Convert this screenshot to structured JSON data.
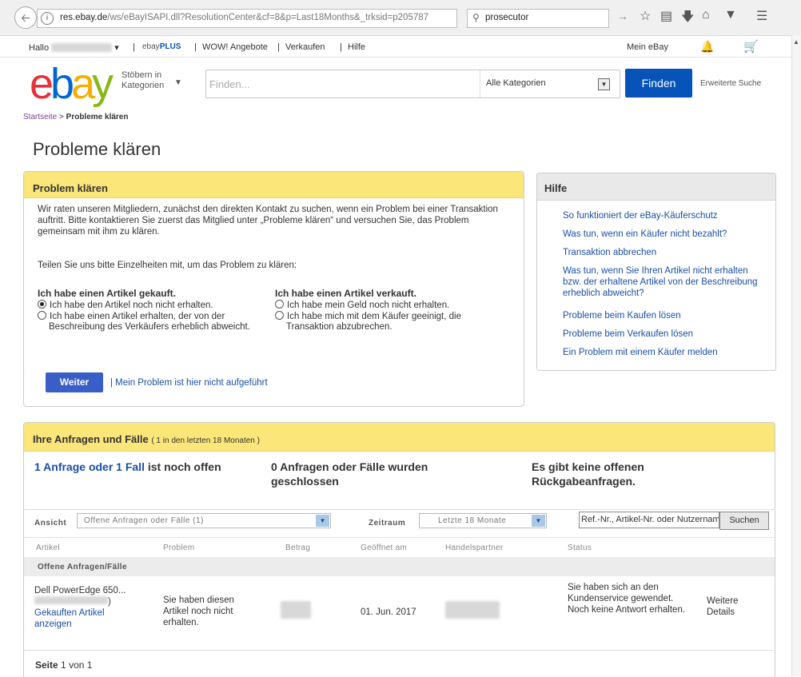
{
  "browser": {
    "url_domain": "res.ebay.de",
    "url_path": "/ws/eBayISAPI.dll?ResolutionCenter&cf=8&p=Last18Months&_trksid=p205787",
    "search_value": "prosecutor"
  },
  "topnav": {
    "greeting": "Hallo",
    "ebayplus_prefix": "ebay",
    "ebayplus_suffix": "PLUS",
    "wow": "WOW! Angebote",
    "sell": "Verkaufen",
    "help": "Hilfe",
    "my_ebay": "Mein eBay"
  },
  "header": {
    "logo": {
      "e": "e",
      "b": "b",
      "a": "a",
      "y": "y"
    },
    "browse_line1": "Stöbern in",
    "browse_line2": "Kategorien",
    "search_placeholder": "Finden...",
    "category": "Alle Kategorien",
    "find_button": "Finden",
    "advanced_search": "Erweiterte Suche"
  },
  "breadcrumb": {
    "home": "Startseite",
    "sep": " > ",
    "current": "Probleme klären"
  },
  "page_title": "Probleme klären",
  "problem": {
    "title": "Problem klären",
    "intro": "Wir raten unseren Mitgliedern, zunächst den direkten Kontakt zu suchen, wenn ein Problem bei einer Transaktion auftritt. Bitte kontaktieren Sie zuerst das Mitglied unter „Probleme klären“ und versuchen Sie, das Problem gemeinsam mit ihm zu klären.",
    "prompt": "Teilen Sie uns bitte Einzelheiten mit, um das Problem zu klären:",
    "bought": {
      "heading": "Ich habe einen Artikel gekauft.",
      "opt1": "Ich habe den Artikel noch nicht erhalten.",
      "opt2": "Ich habe einen Artikel erhalten, der von der Beschreibung des Verkäufers erheblich abweicht."
    },
    "sold": {
      "heading": "Ich habe einen Artikel verkauft.",
      "opt1": "Ich habe mein Geld noch nicht erhalten.",
      "opt2": "Ich habe mich mit dem Käufer geeinigt, die Transaktion abzubrechen."
    },
    "continue_button": "Weiter",
    "not_listed": "| Mein Problem ist hier nicht aufgeführt"
  },
  "help": {
    "title": "Hilfe",
    "links": [
      "So funktioniert der eBay-Käuferschutz",
      "Was tun, wenn ein Käufer nicht bezahlt?",
      "Transaktion abbrechen",
      "Was tun, wenn Sie Ihren Artikel nicht erhalten bzw. der erhaltene Artikel von der Beschreibung erheblich abweicht?",
      "Probleme beim Kaufen lösen",
      "Probleme beim Verkaufen lösen",
      "Ein Problem mit einem Käufer melden"
    ]
  },
  "requests": {
    "title": "Ihre Anfragen und Fälle",
    "subtitle": "( 1 in den letzten 18 Monaten )",
    "summary1_link": "1 Anfrage oder 1 Fall",
    "summary1_rest": " ist noch offen",
    "summary2": "0 Anfragen oder Fälle wurden geschlossen",
    "summary3": "Es gibt keine offenen Rückgabeanfragen.",
    "view_label": "Ansicht",
    "view_value": "Offene Anfragen oder Fälle (1)",
    "period_label": "Zeitraum",
    "period_value": "Letzte 18 Monate",
    "ref_placeholder": "Ref.-Nr., Artikel-Nr. oder Nutzername",
    "search_button": "Suchen",
    "columns": [
      "Artikel",
      "Problem",
      "Betrag",
      "Geöffnet am",
      "Handelspartner",
      "Status"
    ],
    "group_label": "Offene Anfragen/Fälle",
    "row": {
      "item_title": "Dell PowerEdge 650...",
      "view_item_link": "Gekauften Artikel anzeigen",
      "problem": "Sie haben diesen Artikel noch nicht erhalten.",
      "opened": "01. Jun. 2017",
      "status": "Sie haben sich an den Kundenservice gewendet. Noch keine Antwort erhalten.",
      "details_link": "Weitere Details"
    },
    "pager_label": "Seite",
    "pager_current": "1",
    "pager_of": "von 1"
  }
}
